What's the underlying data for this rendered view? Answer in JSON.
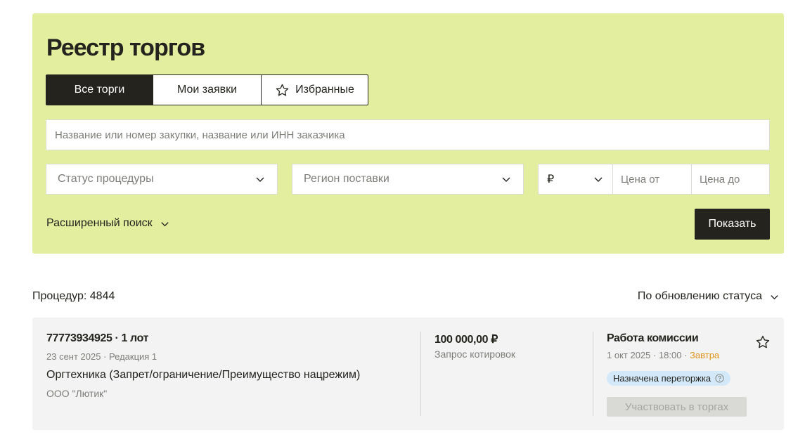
{
  "header": {
    "title": "Реестр торгов"
  },
  "tabs": [
    {
      "label": "Все торги",
      "active": true
    },
    {
      "label": "Мои заявки",
      "active": false
    },
    {
      "label": "Избранные",
      "active": false,
      "icon": "star-outline-icon"
    }
  ],
  "search": {
    "placeholder": "Название или номер закупки, название или ИНН заказчика",
    "value": ""
  },
  "filters": {
    "status_placeholder": "Статус процедуры",
    "region_placeholder": "Регион поставки",
    "currency": "₽",
    "price_from_placeholder": "Цена от",
    "price_to_placeholder": "Цена до",
    "advanced_label": "Расширенный поиск",
    "show_label": "Показать"
  },
  "results": {
    "count_label": "Процедур: 4844",
    "sort_label": "По обновлению статуса"
  },
  "procedures": [
    {
      "number_lots": "77773934925 · 1 лот",
      "date_revision": "23 сент 2025 · Редакция 1",
      "name": "Оргтехника  (Запрет/ограничение/Преимущество нацрежим)",
      "organization": "ООО \"Лютик\"",
      "price": "100 000,00 ₽",
      "procedure_type": "Запрос котировок",
      "status": "Работа комиссии",
      "deadline": "1 окт 2025 · 18:00 · ",
      "deadline_relative": "Завтра",
      "badge": "Назначена переторжка",
      "join_label": "Участвовать в торгах"
    }
  ],
  "colors": {
    "panel_bg": "#e3ef9e",
    "dark": "#24231d",
    "card_bg": "#f3f3f3",
    "badge_bg": "#d3e9fa",
    "accent_orange": "#e0941c"
  }
}
